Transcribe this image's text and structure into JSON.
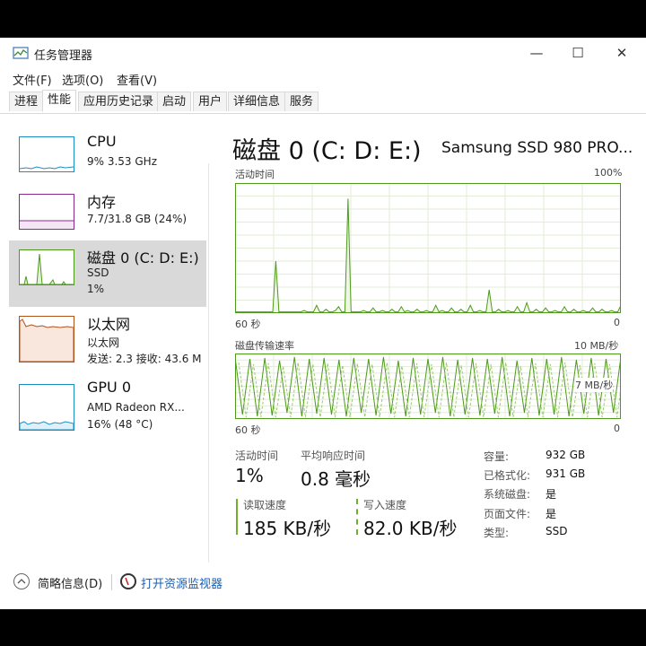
{
  "window": {
    "title": "任务管理器",
    "controls": {
      "minimize": "—",
      "maximize": "☐",
      "close": "✕"
    }
  },
  "menu": {
    "file": "文件(F)",
    "options": "选项(O)",
    "view": "查看(V)"
  },
  "tabs": {
    "processes": "进程",
    "performance": "性能",
    "app_history": "应用历史记录",
    "startup": "启动",
    "users": "用户",
    "details": "详细信息",
    "services": "服务"
  },
  "sidebar": {
    "cpu": {
      "title": "CPU",
      "sub1": "9%  3.53 GHz",
      "color": "#1a8fc4"
    },
    "memory": {
      "title": "内存",
      "sub1": "7.7/31.8 GB (24%)",
      "color": "#8b2a8e"
    },
    "disk": {
      "title": "磁盘 0 (C: D: E:)",
      "sub1": "SSD",
      "sub2": "1%",
      "color": "#4d9a1a"
    },
    "ethernet": {
      "title": "以太网",
      "sub1": "以太网",
      "sub2": "发送: 2.3  接收: 43.6 M",
      "color": "#b0521a"
    },
    "gpu": {
      "title": "GPU 0",
      "sub1": "AMD Radeon RX...",
      "sub2": "16% (48 °C)",
      "color": "#1a8fc4"
    }
  },
  "main": {
    "title": "磁盘 0 (C: D: E:)",
    "model": "Samsung SSD 980 PRO...",
    "activity_graph": {
      "label": "活动时间",
      "max": "100%",
      "time_left": "60 秒",
      "time_right": "0",
      "values": [
        1,
        1,
        1,
        1,
        1,
        1,
        1,
        1,
        1,
        1,
        1,
        1,
        1,
        40,
        1,
        1,
        1,
        1,
        1,
        1,
        1,
        1,
        2,
        1,
        1,
        1,
        6,
        1,
        1,
        3,
        1,
        1,
        2,
        5,
        1,
        1,
        88,
        1,
        1,
        1,
        1,
        2,
        1,
        1,
        4,
        1,
        1,
        2,
        1,
        1,
        3,
        1,
        1,
        5,
        1,
        2,
        1,
        1,
        3,
        1,
        1,
        2,
        1,
        1,
        6,
        1,
        2,
        1,
        1,
        4,
        1,
        1,
        3,
        1,
        1,
        6,
        1,
        1,
        2,
        1,
        1,
        18,
        1,
        1,
        3,
        1,
        1,
        2,
        1,
        1,
        5,
        1,
        1,
        8,
        1,
        1,
        3,
        1,
        1,
        4,
        1,
        1,
        2,
        1,
        1,
        5,
        1,
        1,
        3,
        1,
        1,
        2,
        1,
        1,
        4,
        1,
        1,
        3,
        1,
        1,
        2,
        1,
        1,
        6
      ]
    },
    "transfer_graph": {
      "label": "磁盘传输速率",
      "max": "10 MB/秒",
      "mid": "7 MB/秒",
      "time_left": "60 秒",
      "time_right": "0"
    },
    "stats": {
      "active_time_label": "活动时间",
      "active_time_value": "1%",
      "response_label": "平均响应时间",
      "response_value": "0.8 毫秒",
      "read_label": "读取速度",
      "read_value": "185 KB/秒",
      "write_label": "写入速度",
      "write_value": "82.0 KB/秒"
    },
    "info": {
      "capacity_k": "容量:",
      "capacity_v": "932 GB",
      "formatted_k": "已格式化:",
      "formatted_v": "931 GB",
      "system_k": "系统磁盘:",
      "system_v": "是",
      "pagefile_k": "页面文件:",
      "pagefile_v": "是",
      "type_k": "类型:",
      "type_v": "SSD"
    }
  },
  "footer": {
    "brief": "简略信息(D)",
    "resource_monitor": "打开资源监视器"
  },
  "colors": {
    "disk_green": "#4d9a1a",
    "disk_fill": "#eef6e6",
    "grid": "#e3ecd9"
  }
}
